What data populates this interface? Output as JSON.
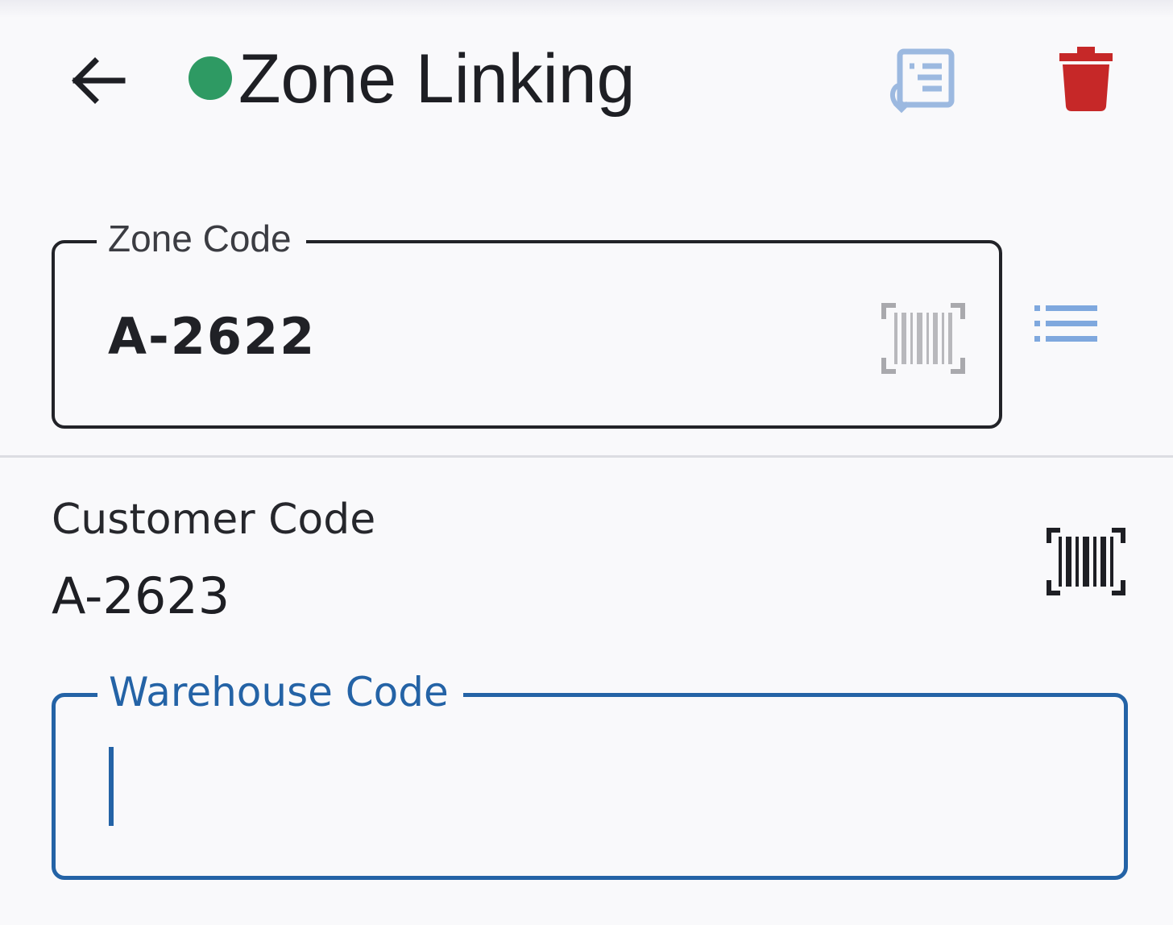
{
  "app_bar": {
    "title": "Zone Linking",
    "status_dot_color": "#2e9a63",
    "back_icon": "arrow-left-icon",
    "link_icon": "list-transfer-icon",
    "delete_icon": "trash-icon",
    "delete_color": "#c62828"
  },
  "zone_code": {
    "label": "Zone Code",
    "value": "A-2622",
    "scan_icon": "barcode-scan-icon",
    "list_icon": "list-icon"
  },
  "customer_code": {
    "label": "Customer Code",
    "value": "A-2623",
    "scan_icon": "barcode-scan-icon"
  },
  "warehouse_code": {
    "label": "Warehouse Code",
    "value": "",
    "accent_color": "#2463a6"
  }
}
